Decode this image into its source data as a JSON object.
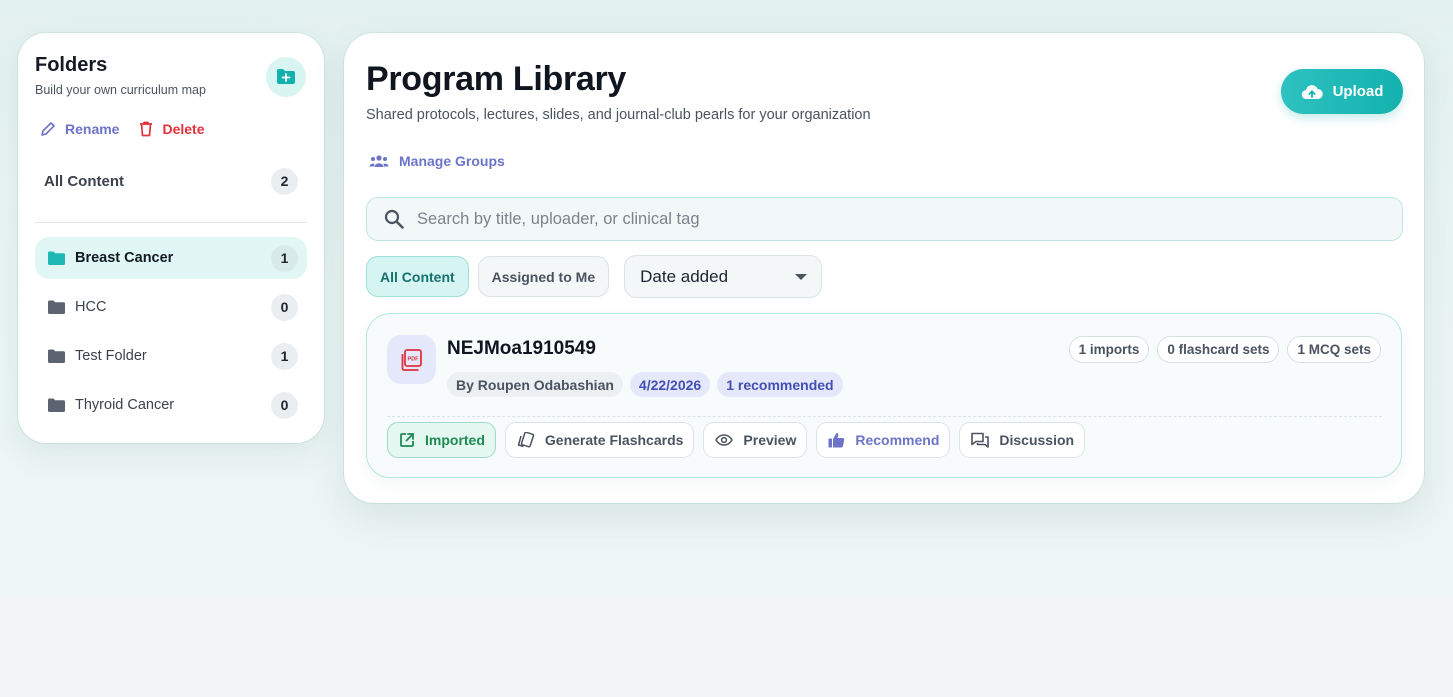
{
  "colors": {
    "accent": "#13b1ad",
    "link": "#6b74c9",
    "danger": "#e0323c",
    "success": "#1e8a52",
    "pdf": "#e0323c"
  },
  "folders": {
    "title": "Folders",
    "subtitle": "Build your own curriculum map",
    "new_folder_icon": "folder-plus-icon",
    "rename_label": "Rename",
    "delete_label": "Delete",
    "all_content": {
      "label": "All Content",
      "count": "2"
    },
    "items": [
      {
        "name": "Breast Cancer",
        "count": "1",
        "active": true
      },
      {
        "name": "HCC",
        "count": "0",
        "active": false
      },
      {
        "name": "Test Folder",
        "count": "1",
        "active": false
      },
      {
        "name": "Thyroid Cancer",
        "count": "0",
        "active": false
      }
    ]
  },
  "main": {
    "title": "Program Library",
    "subtitle": "Shared protocols, lectures, slides, and journal-club pearls for your organization",
    "upload_label": "Upload",
    "manage_groups_label": "Manage Groups",
    "search": {
      "placeholder": "Search by title, uploader, or clinical tag",
      "value": ""
    },
    "filters": {
      "all_content": "All Content",
      "assigned": "Assigned to Me",
      "sort_selected": "Date added"
    }
  },
  "card": {
    "title": "NEJMoa1910549",
    "uploader": "By Roupen Odabashian",
    "date": "4/22/2026",
    "recommended": "1 recommended",
    "stats": {
      "imports": "1 imports",
      "flashcards": "0 flashcard sets",
      "mcq": "1 MCQ sets"
    },
    "actions": {
      "imported": "Imported",
      "flashcards": "Generate Flashcards",
      "preview": "Preview",
      "recommend": "Recommend",
      "discussion": "Discussion"
    }
  }
}
